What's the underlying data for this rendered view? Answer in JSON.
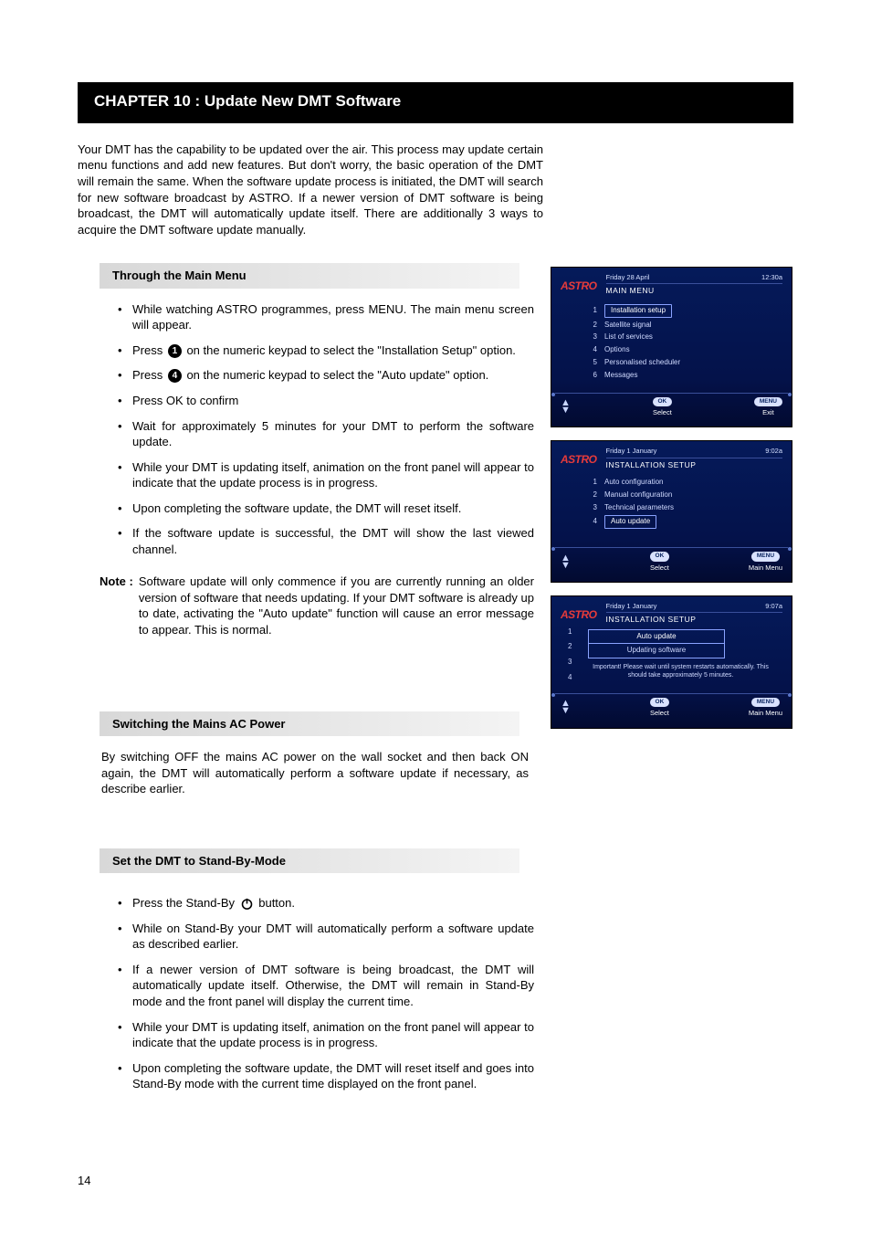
{
  "chapter_title": "CHAPTER 10 : Update New DMT Software",
  "intro": "Your DMT has the capability to be updated over the air.  This process may update certain menu functions and add new features.  But don't worry, the basic operation of the DMT will remain the same.  When the software update process is initiated, the DMT will search for new software broadcast by ASTRO.  If a newer version of DMT software is being broadcast, the DMT will automatically update itself.  There are additionally 3 ways to acquire the DMT software update manually.",
  "sections": {
    "main_menu": {
      "title": "Through the Main Menu",
      "steps": [
        {
          "pre": "While watching ASTRO programmes, press MENU. The main menu screen will appear."
        },
        {
          "pre": "Press ",
          "circle": "1",
          "post": " on the numeric keypad to select the \"Installation Setup\" option."
        },
        {
          "pre": "Press ",
          "circle": "4",
          "post": " on the numeric keypad to select the \"Auto update\" option."
        },
        {
          "pre": "Press OK to confirm"
        },
        {
          "pre": "Wait for approximately 5 minutes for your DMT to perform the software update."
        },
        {
          "pre": "While your DMT is updating itself, animation on the front panel will appear to indicate that the update process is in progress."
        },
        {
          "pre": "Upon completing the software update, the DMT will reset itself."
        },
        {
          "pre": "If the software update is successful, the DMT will show the last viewed channel."
        }
      ],
      "note_label": "Note :",
      "note_text": "Software update will only commence if you are currently running an older version of software that needs updating.  If your DMT software is already up to date, activating the \"Auto update\" function will cause an error message to appear.  This is normal."
    },
    "ac_power": {
      "title": "Switching the Mains AC Power",
      "text": "By switching OFF the mains AC power on the wall socket and then back ON again, the DMT will automatically perform a software update if necessary, as describe earlier."
    },
    "standby": {
      "title": "Set the DMT to Stand-By-Mode",
      "steps": [
        {
          "pre": "Press the Stand-By ",
          "power": true,
          "post": " button."
        },
        {
          "pre": "While on Stand-By your DMT will automatically perform a software update as described earlier."
        },
        {
          "pre": "If a newer version of DMT software is being broadcast, the DMT will automatically update itself.  Otherwise, the DMT will remain in Stand-By mode and the front panel will display the current time."
        },
        {
          "pre": "While your DMT is updating itself, animation on the front panel will appear to indicate that the update process is in progress."
        },
        {
          "pre": "Upon completing the software update, the DMT will reset itself and goes into Stand-By mode with the current time displayed on the front panel."
        }
      ]
    }
  },
  "tv_screens": {
    "logo": "ASTRO",
    "ok_pill": "OK",
    "menu_pill": "MENU",
    "select_label": "Select",
    "s1": {
      "date": "Friday 28 April",
      "time": "12:30a",
      "title": "MAIN MENU",
      "items": [
        {
          "n": "1",
          "label": "Installation setup",
          "sel": true
        },
        {
          "n": "2",
          "label": "Satellite signal"
        },
        {
          "n": "3",
          "label": "List of services"
        },
        {
          "n": "4",
          "label": "Options"
        },
        {
          "n": "5",
          "label": "Personalised scheduler"
        },
        {
          "n": "6",
          "label": "Messages"
        }
      ],
      "right_label": "Exit"
    },
    "s2": {
      "date": "Friday 1 January",
      "time": "9:02a",
      "title": "INSTALLATION SETUP",
      "items": [
        {
          "n": "1",
          "label": "Auto configuration"
        },
        {
          "n": "2",
          "label": "Manual configuration"
        },
        {
          "n": "3",
          "label": "Technical parameters"
        },
        {
          "n": "4",
          "label": "Auto update",
          "sel": true
        }
      ],
      "right_label": "Main Menu"
    },
    "s3": {
      "date": "Friday 1 January",
      "time": "9:07a",
      "title": "INSTALLATION SETUP",
      "popup_header": "Auto update",
      "popup_msg": "Updating software",
      "warn": "Important! Please wait until system restarts automatically. This should take approximately 5 minutes.",
      "right_label": "Main Menu",
      "side_nums": [
        "1",
        "2",
        "3",
        "4"
      ]
    }
  },
  "page_number": "14"
}
